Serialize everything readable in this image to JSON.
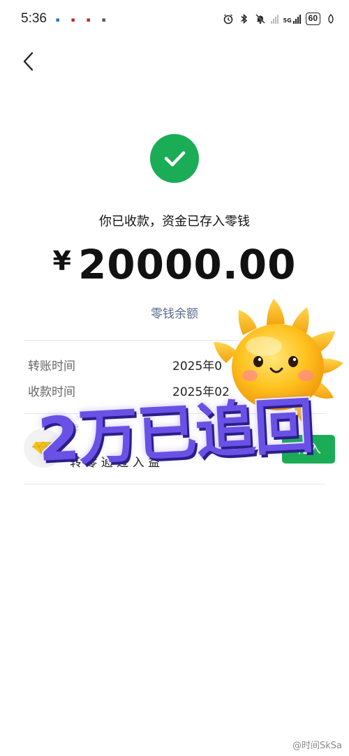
{
  "status_bar": {
    "time": "5:36",
    "notification_icons": [
      "app-notification-icon-1",
      "app-notification-icon-2",
      "app-notification-icon-3",
      "app-notification-icon-4"
    ],
    "network_label": "5G",
    "battery": "60"
  },
  "header": {
    "back_icon": "chevron-left-icon"
  },
  "receipt": {
    "success_icon": "check-circle-icon",
    "message": "你已收款，资金已存入零钱",
    "currency": "¥",
    "amount": "20000.00",
    "balance_link": "零钱余额",
    "details": [
      {
        "label": "转账时间",
        "value": "2025年0"
      },
      {
        "label": "收款时间",
        "value": "2025年02"
      }
    ]
  },
  "promo": {
    "title": "零",
    "text": "转   零   通   过   入   益",
    "button_label": "转入"
  },
  "overlay": {
    "caption": "2万已追回",
    "sticker": "sun-sticker-icon"
  },
  "watermark": "@时间SkSa",
  "colors": {
    "accent_green": "#1aad55",
    "link_blue": "#586b8a",
    "caption_purple": "#6a51e6"
  }
}
